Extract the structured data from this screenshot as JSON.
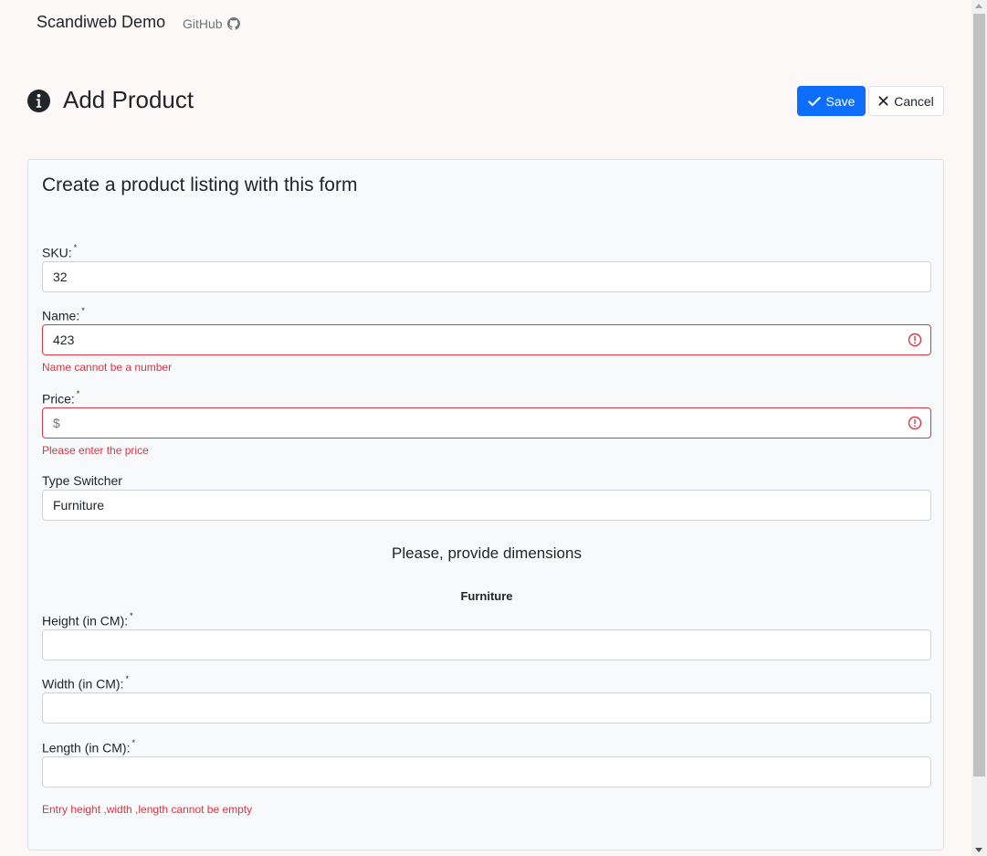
{
  "navbar": {
    "brand": "Scandiweb Demo",
    "github_label": "GitHub",
    "github_icon": "github-icon"
  },
  "header": {
    "title": "Add Product",
    "info_icon": "info-circle-icon",
    "save_label": "Save",
    "cancel_label": "Cancel"
  },
  "form": {
    "title": "Create a product listing with this form",
    "sku": {
      "label": "SKU:",
      "required": "*",
      "value": "32"
    },
    "name": {
      "label": "Name:",
      "required": "*",
      "value": "423",
      "error": "Name cannot be a number"
    },
    "price": {
      "label": "Price:",
      "required": "*",
      "placeholder": "$",
      "error": "Please enter the price"
    },
    "type_switcher": {
      "label": "Type Switcher",
      "selected": "Furniture"
    },
    "dimensions": {
      "title": "Please, provide dimensions",
      "subtitle": "Furniture",
      "height": {
        "label": "Height (in CM):",
        "required": "*"
      },
      "width": {
        "label": "Width (in CM):",
        "required": "*"
      },
      "length": {
        "label": "Length (in CM):",
        "required": "*"
      },
      "error": "Entry height ,width ,length cannot be empty"
    }
  },
  "colors": {
    "primary": "#0d6efd",
    "danger": "#dc3545",
    "background": "#fcf8f7"
  }
}
